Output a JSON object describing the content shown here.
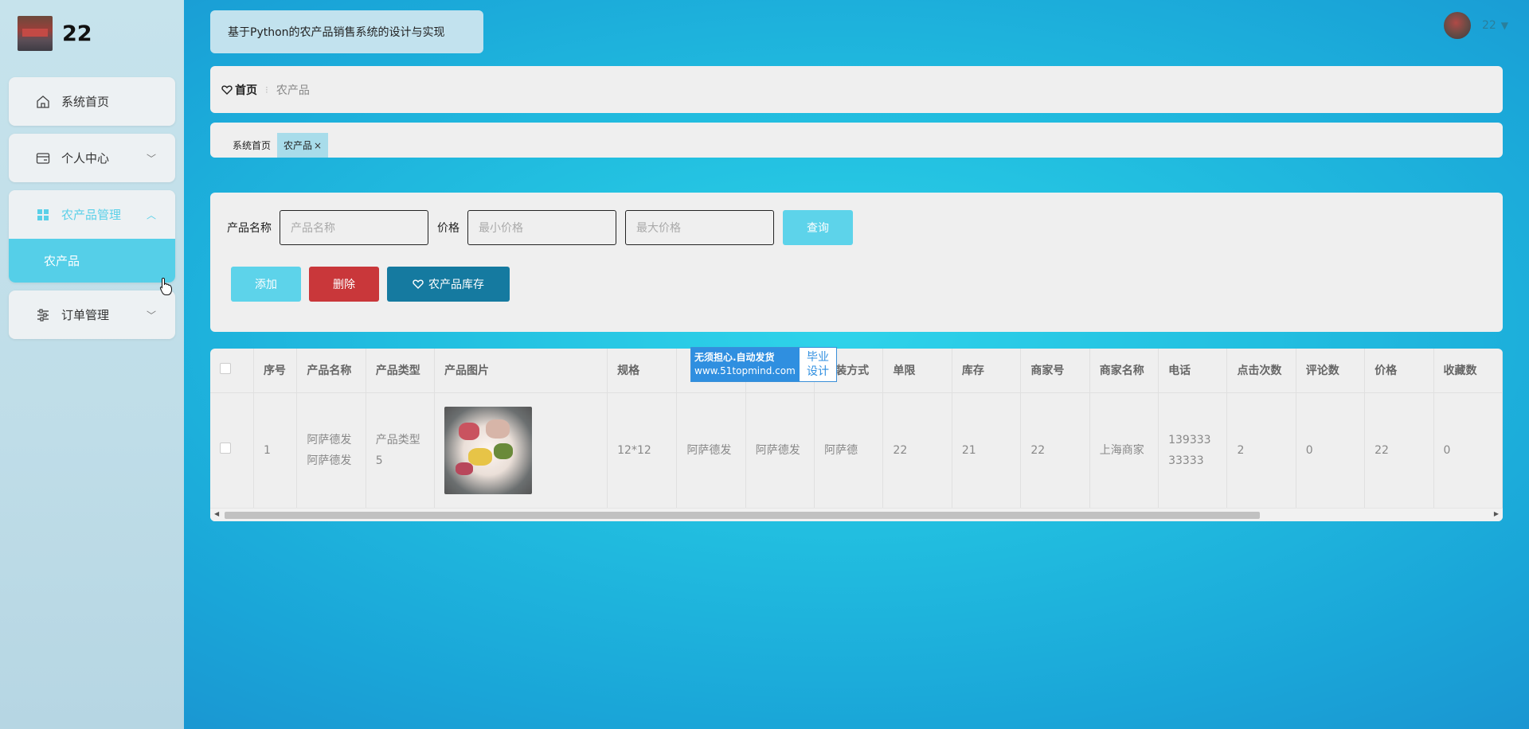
{
  "sidebar": {
    "brand_name": "22",
    "items": [
      {
        "label": "系统首页",
        "icon": "home-icon"
      },
      {
        "label": "个人中心",
        "icon": "wallet-icon"
      },
      {
        "label": "农产品管理",
        "icon": "grid-icon",
        "submenu": [
          "农产品"
        ]
      },
      {
        "label": "订单管理",
        "icon": "sliders-icon"
      }
    ]
  },
  "header": {
    "title": "基于Python的农产品销售系统的设计与实现",
    "user_name": "22"
  },
  "breadcrumb": {
    "home": "首页",
    "current": "农产品"
  },
  "tags": [
    {
      "label": "系统首页"
    },
    {
      "label": "农产品",
      "close": "×"
    }
  ],
  "search": {
    "name_label": "产品名称",
    "name_placeholder": "产品名称",
    "price_label": "价格",
    "min_placeholder": "最小价格",
    "max_placeholder": "最大价格",
    "query_button": "查询",
    "add_button": "添加",
    "delete_button": "删除",
    "stock_button": "农产品库存"
  },
  "table": {
    "columns": [
      "序号",
      "产品名称",
      "产品类型",
      "产品图片",
      "规格",
      "",
      "",
      "包装方式",
      "单限",
      "库存",
      "商家号",
      "商家名称",
      "电话",
      "点击次数",
      "评论数",
      "价格",
      "收藏数"
    ],
    "rows": [
      [
        "1",
        "阿萨德发阿萨德发",
        "产品类型5",
        "",
        "12*12",
        "阿萨德发",
        "阿萨德发",
        "阿萨德",
        "22",
        "21",
        "22",
        "上海商家",
        "13933333333",
        "2",
        "0",
        "22",
        "0"
      ]
    ]
  },
  "watermark": {
    "line1": "无须担心.自动发货",
    "line2": "www.51topmind.com",
    "right1": "毕业",
    "right2": "设计"
  }
}
